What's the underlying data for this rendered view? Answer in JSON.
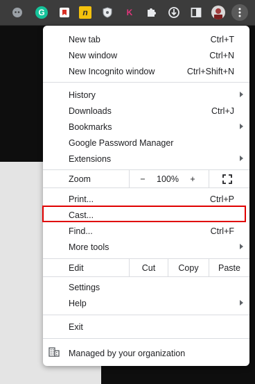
{
  "toolbar": {
    "extensions": [
      "chat-extension",
      "grammarly",
      "bookmark-extension",
      "norton-extension",
      "shield-extension",
      "k-extension",
      "extensions-puzzle",
      "downloads",
      "side-panel",
      "profile-avatar",
      "menu-kebab"
    ],
    "grammarly_letter": "G",
    "k_letter": "K",
    "n_letter": "n"
  },
  "menu": {
    "new_tab": {
      "label": "New tab",
      "shortcut": "Ctrl+T"
    },
    "new_window": {
      "label": "New window",
      "shortcut": "Ctrl+N"
    },
    "new_incognito": {
      "label": "New Incognito window",
      "shortcut": "Ctrl+Shift+N"
    },
    "history": {
      "label": "History"
    },
    "downloads": {
      "label": "Downloads",
      "shortcut": "Ctrl+J"
    },
    "bookmarks": {
      "label": "Bookmarks"
    },
    "password_manager": {
      "label": "Google Password Manager"
    },
    "extensions": {
      "label": "Extensions"
    },
    "zoom": {
      "label": "Zoom",
      "minus": "−",
      "value": "100%",
      "plus": "+"
    },
    "print": {
      "label": "Print...",
      "shortcut": "Ctrl+P"
    },
    "cast": {
      "label": "Cast..."
    },
    "find": {
      "label": "Find...",
      "shortcut": "Ctrl+F"
    },
    "more_tools": {
      "label": "More tools"
    },
    "edit": {
      "label": "Edit",
      "cut": "Cut",
      "copy": "Copy",
      "paste": "Paste"
    },
    "settings": {
      "label": "Settings"
    },
    "help": {
      "label": "Help"
    },
    "exit": {
      "label": "Exit"
    },
    "managed": {
      "label": "Managed by your organization"
    }
  },
  "colors": {
    "highlight": "#e00000",
    "grammarly": "#15c39a",
    "k_extension": "#e0357a"
  }
}
